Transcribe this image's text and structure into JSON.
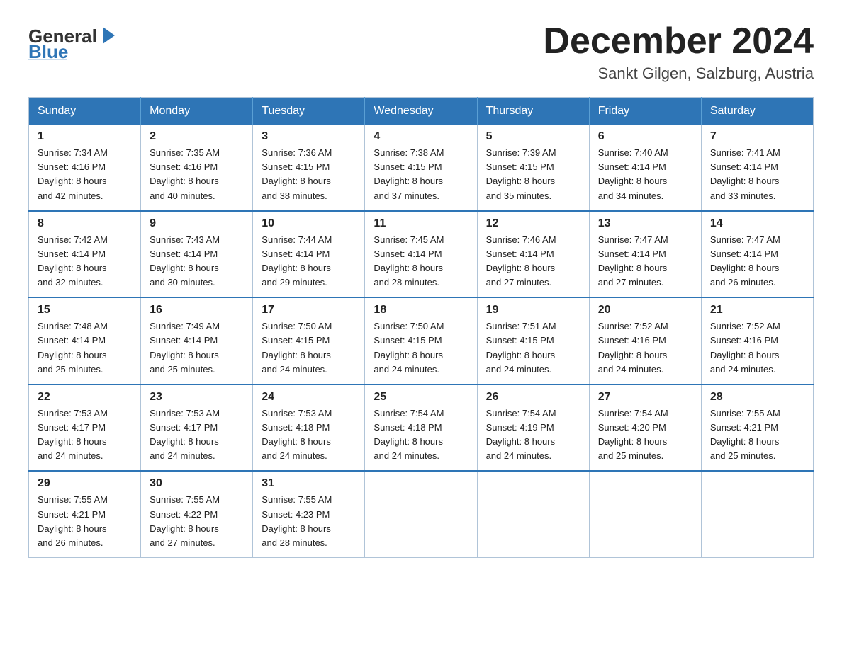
{
  "header": {
    "logo_general": "General",
    "logo_blue": "Blue",
    "title": "December 2024",
    "location": "Sankt Gilgen, Salzburg, Austria"
  },
  "days_of_week": [
    "Sunday",
    "Monday",
    "Tuesday",
    "Wednesday",
    "Thursday",
    "Friday",
    "Saturday"
  ],
  "weeks": [
    [
      {
        "day": "1",
        "sunrise": "7:34 AM",
        "sunset": "4:16 PM",
        "daylight": "8 hours and 42 minutes."
      },
      {
        "day": "2",
        "sunrise": "7:35 AM",
        "sunset": "4:16 PM",
        "daylight": "8 hours and 40 minutes."
      },
      {
        "day": "3",
        "sunrise": "7:36 AM",
        "sunset": "4:15 PM",
        "daylight": "8 hours and 38 minutes."
      },
      {
        "day": "4",
        "sunrise": "7:38 AM",
        "sunset": "4:15 PM",
        "daylight": "8 hours and 37 minutes."
      },
      {
        "day": "5",
        "sunrise": "7:39 AM",
        "sunset": "4:15 PM",
        "daylight": "8 hours and 35 minutes."
      },
      {
        "day": "6",
        "sunrise": "7:40 AM",
        "sunset": "4:14 PM",
        "daylight": "8 hours and 34 minutes."
      },
      {
        "day": "7",
        "sunrise": "7:41 AM",
        "sunset": "4:14 PM",
        "daylight": "8 hours and 33 minutes."
      }
    ],
    [
      {
        "day": "8",
        "sunrise": "7:42 AM",
        "sunset": "4:14 PM",
        "daylight": "8 hours and 32 minutes."
      },
      {
        "day": "9",
        "sunrise": "7:43 AM",
        "sunset": "4:14 PM",
        "daylight": "8 hours and 30 minutes."
      },
      {
        "day": "10",
        "sunrise": "7:44 AM",
        "sunset": "4:14 PM",
        "daylight": "8 hours and 29 minutes."
      },
      {
        "day": "11",
        "sunrise": "7:45 AM",
        "sunset": "4:14 PM",
        "daylight": "8 hours and 28 minutes."
      },
      {
        "day": "12",
        "sunrise": "7:46 AM",
        "sunset": "4:14 PM",
        "daylight": "8 hours and 27 minutes."
      },
      {
        "day": "13",
        "sunrise": "7:47 AM",
        "sunset": "4:14 PM",
        "daylight": "8 hours and 27 minutes."
      },
      {
        "day": "14",
        "sunrise": "7:47 AM",
        "sunset": "4:14 PM",
        "daylight": "8 hours and 26 minutes."
      }
    ],
    [
      {
        "day": "15",
        "sunrise": "7:48 AM",
        "sunset": "4:14 PM",
        "daylight": "8 hours and 25 minutes."
      },
      {
        "day": "16",
        "sunrise": "7:49 AM",
        "sunset": "4:14 PM",
        "daylight": "8 hours and 25 minutes."
      },
      {
        "day": "17",
        "sunrise": "7:50 AM",
        "sunset": "4:15 PM",
        "daylight": "8 hours and 24 minutes."
      },
      {
        "day": "18",
        "sunrise": "7:50 AM",
        "sunset": "4:15 PM",
        "daylight": "8 hours and 24 minutes."
      },
      {
        "day": "19",
        "sunrise": "7:51 AM",
        "sunset": "4:15 PM",
        "daylight": "8 hours and 24 minutes."
      },
      {
        "day": "20",
        "sunrise": "7:52 AM",
        "sunset": "4:16 PM",
        "daylight": "8 hours and 24 minutes."
      },
      {
        "day": "21",
        "sunrise": "7:52 AM",
        "sunset": "4:16 PM",
        "daylight": "8 hours and 24 minutes."
      }
    ],
    [
      {
        "day": "22",
        "sunrise": "7:53 AM",
        "sunset": "4:17 PM",
        "daylight": "8 hours and 24 minutes."
      },
      {
        "day": "23",
        "sunrise": "7:53 AM",
        "sunset": "4:17 PM",
        "daylight": "8 hours and 24 minutes."
      },
      {
        "day": "24",
        "sunrise": "7:53 AM",
        "sunset": "4:18 PM",
        "daylight": "8 hours and 24 minutes."
      },
      {
        "day": "25",
        "sunrise": "7:54 AM",
        "sunset": "4:18 PM",
        "daylight": "8 hours and 24 minutes."
      },
      {
        "day": "26",
        "sunrise": "7:54 AM",
        "sunset": "4:19 PM",
        "daylight": "8 hours and 24 minutes."
      },
      {
        "day": "27",
        "sunrise": "7:54 AM",
        "sunset": "4:20 PM",
        "daylight": "8 hours and 25 minutes."
      },
      {
        "day": "28",
        "sunrise": "7:55 AM",
        "sunset": "4:21 PM",
        "daylight": "8 hours and 25 minutes."
      }
    ],
    [
      {
        "day": "29",
        "sunrise": "7:55 AM",
        "sunset": "4:21 PM",
        "daylight": "8 hours and 26 minutes."
      },
      {
        "day": "30",
        "sunrise": "7:55 AM",
        "sunset": "4:22 PM",
        "daylight": "8 hours and 27 minutes."
      },
      {
        "day": "31",
        "sunrise": "7:55 AM",
        "sunset": "4:23 PM",
        "daylight": "8 hours and 28 minutes."
      },
      null,
      null,
      null,
      null
    ]
  ],
  "labels": {
    "sunrise_prefix": "Sunrise: ",
    "sunset_prefix": "Sunset: ",
    "daylight_prefix": "Daylight: "
  }
}
